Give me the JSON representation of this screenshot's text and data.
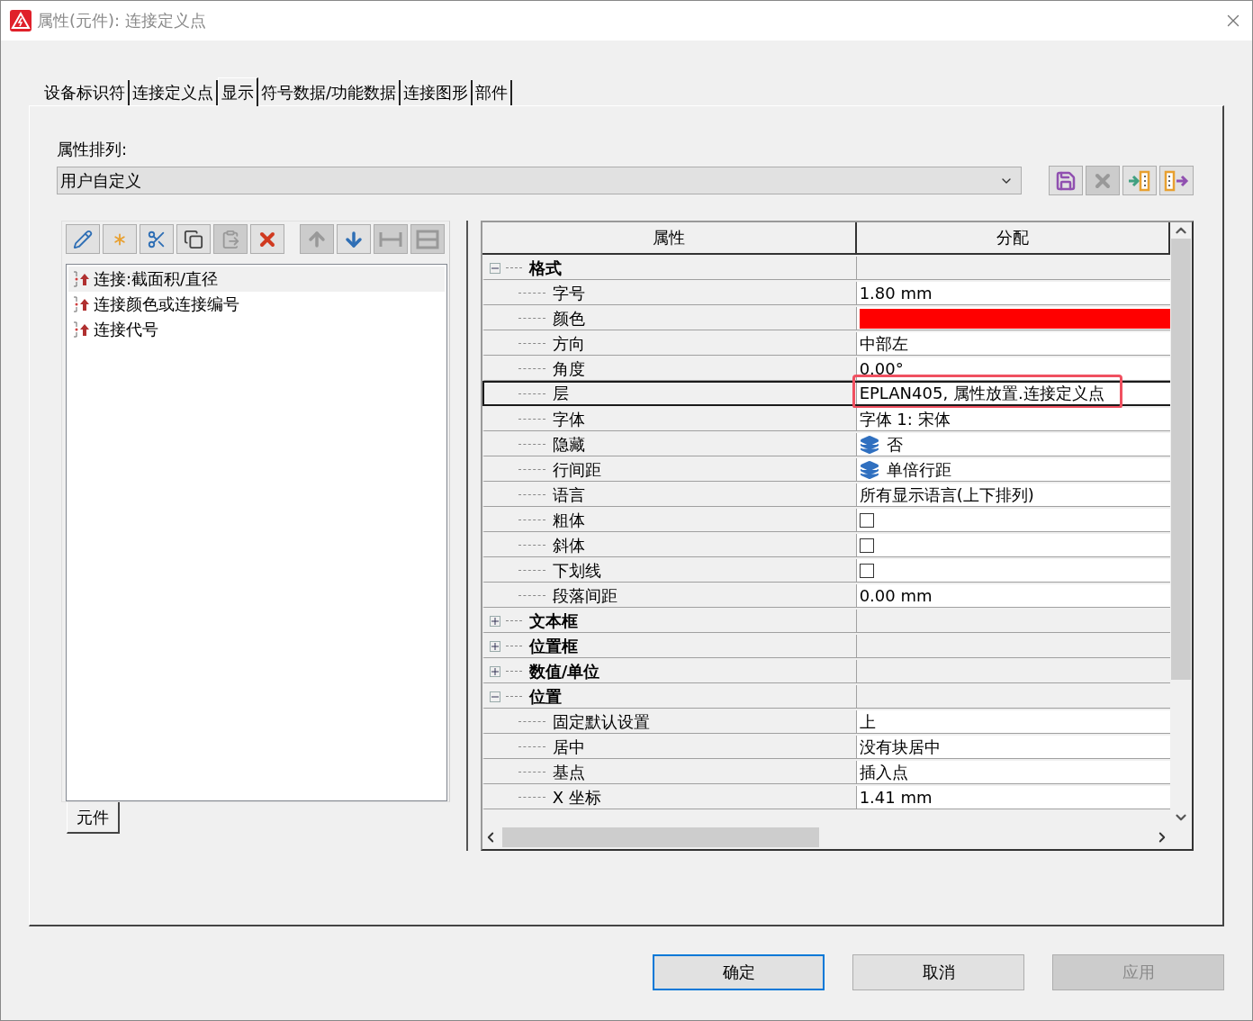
{
  "window": {
    "title": "属性(元件): 连接定义点"
  },
  "tabs": [
    {
      "label": "设备标识符",
      "selected": false
    },
    {
      "label": "连接定义点",
      "selected": false
    },
    {
      "label": "显示",
      "selected": true
    },
    {
      "label": "符号数据/功能数据",
      "selected": false
    },
    {
      "label": "连接图形",
      "selected": false
    },
    {
      "label": "部件",
      "selected": false
    }
  ],
  "arrangement": {
    "label": "属性排列:",
    "value": "用户自定义"
  },
  "arrangement_buttons": [
    {
      "disabled": false
    },
    {
      "disabled": true
    },
    {
      "disabled": false
    },
    {
      "disabled": false
    }
  ],
  "list_toolbar": [
    {
      "disabled": false
    },
    {
      "disabled": false
    },
    {
      "disabled": false
    },
    {
      "disabled": false
    },
    {
      "disabled": true
    },
    {
      "disabled": false
    },
    {
      "disabled": true
    },
    {
      "disabled": false
    },
    {
      "disabled": true
    },
    {
      "disabled": true
    }
  ],
  "list_items": [
    {
      "label": "连接:截面积/直径",
      "selected": true
    },
    {
      "label": "连接颜色或连接编号",
      "selected": false
    },
    {
      "label": "连接代号",
      "selected": false
    }
  ],
  "list_tab": {
    "label": "元件"
  },
  "grid": {
    "columns": [
      "属性",
      "分配"
    ],
    "rows": [
      {
        "kind": "group",
        "name": "格式",
        "expanded": true,
        "selected": false,
        "children": [
          {
            "kind": "text",
            "name": "字号",
            "value": "1.80 mm",
            "selected": false
          },
          {
            "kind": "color",
            "name": "颜色",
            "color": "#ff0000",
            "selected": false
          },
          {
            "kind": "text",
            "name": "方向",
            "value": "中部左",
            "selected": false
          },
          {
            "kind": "text",
            "name": "角度",
            "value": "0.00°",
            "selected": false
          },
          {
            "kind": "text",
            "name": "层",
            "value": "EPLAN405, 属性放置.连接定义点",
            "selected": true,
            "highlight": true
          },
          {
            "kind": "text",
            "name": "字体",
            "value": "字体 1: 宋体",
            "selected": false
          },
          {
            "kind": "layers",
            "name": "隐藏",
            "value": "否",
            "selected": false
          },
          {
            "kind": "layers",
            "name": "行间距",
            "value": "单倍行距",
            "selected": false
          },
          {
            "kind": "text",
            "name": "语言",
            "value": "所有显示语言(上下排列)",
            "selected": false
          },
          {
            "kind": "checkbox",
            "name": "粗体",
            "checked": false,
            "selected": false
          },
          {
            "kind": "checkbox",
            "name": "斜体",
            "checked": false,
            "selected": false
          },
          {
            "kind": "checkbox",
            "name": "下划线",
            "checked": false,
            "selected": false
          },
          {
            "kind": "text",
            "name": "段落间距",
            "value": "0.00 mm",
            "selected": false
          }
        ]
      },
      {
        "kind": "group",
        "name": "文本框",
        "expanded": false,
        "selected": false
      },
      {
        "kind": "group",
        "name": "位置框",
        "expanded": false,
        "selected": false
      },
      {
        "kind": "group",
        "name": "数值/单位",
        "expanded": false,
        "selected": false
      },
      {
        "kind": "group",
        "name": "位置",
        "expanded": true,
        "selected": false,
        "children": [
          {
            "kind": "text",
            "name": "固定默认设置",
            "value": "上",
            "selected": false
          },
          {
            "kind": "text",
            "name": "居中",
            "value": "没有块居中",
            "selected": false
          },
          {
            "kind": "text",
            "name": "基点",
            "value": "插入点",
            "selected": false
          },
          {
            "kind": "text",
            "name": "X 坐标",
            "value": "1.41 mm",
            "selected": false
          }
        ]
      }
    ]
  },
  "buttons": [
    {
      "label": "确定",
      "default": true,
      "disabled": false
    },
    {
      "label": "取消",
      "default": false,
      "disabled": false
    },
    {
      "label": "应用",
      "default": false,
      "disabled": true
    }
  ]
}
